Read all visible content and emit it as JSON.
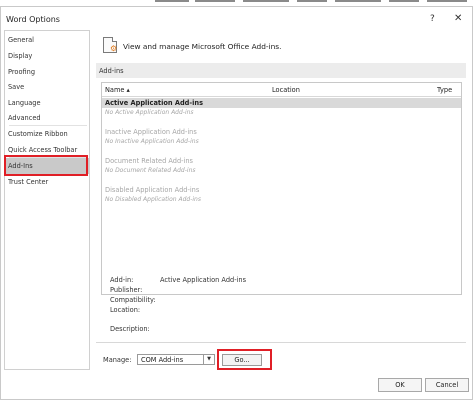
{
  "window": {
    "title": "Word Options",
    "help": "?",
    "close": "✕"
  },
  "sidebar": {
    "items": [
      {
        "label": "General"
      },
      {
        "label": "Display"
      },
      {
        "label": "Proofing"
      },
      {
        "label": "Save"
      },
      {
        "label": "Language"
      },
      {
        "label": "Advanced"
      },
      {
        "label": "Customize Ribbon"
      },
      {
        "label": "Quick Access Toolbar"
      },
      {
        "label": "Add-Ins",
        "selected": true
      },
      {
        "label": "Trust Center"
      }
    ]
  },
  "main": {
    "heading": "View and manage Microsoft Office Add-ins.",
    "section_title": "Add-ins",
    "columns": {
      "name": "Name ▴",
      "location": "Location",
      "type": "Type"
    },
    "groups": [
      {
        "title": "Active Application Add-ins",
        "empty": "No Active Application Add-ins"
      },
      {
        "title": "Inactive Application Add-ins",
        "empty": "No Inactive Application Add-ins"
      },
      {
        "title": "Document Related Add-ins",
        "empty": "No Document Related Add-ins"
      },
      {
        "title": "Disabled Application Add-ins",
        "empty": "No Disabled Application Add-ins"
      }
    ],
    "details": {
      "addin_label": "Add-in:",
      "addin_value": "Active Application Add-ins",
      "publisher_label": "Publisher:",
      "compatibility_label": "Compatibility:",
      "location_label": "Location:",
      "description_label": "Description:"
    },
    "manage": {
      "label": "Manage:",
      "selected": "COM Add-ins",
      "go_label": "Go..."
    }
  },
  "footer": {
    "ok_label": "OK",
    "cancel_label": "Cancel"
  },
  "colors": {
    "highlight": "#e01f26",
    "selected_bg": "#c9c9c9",
    "accent_icon": "#e07b1f"
  }
}
